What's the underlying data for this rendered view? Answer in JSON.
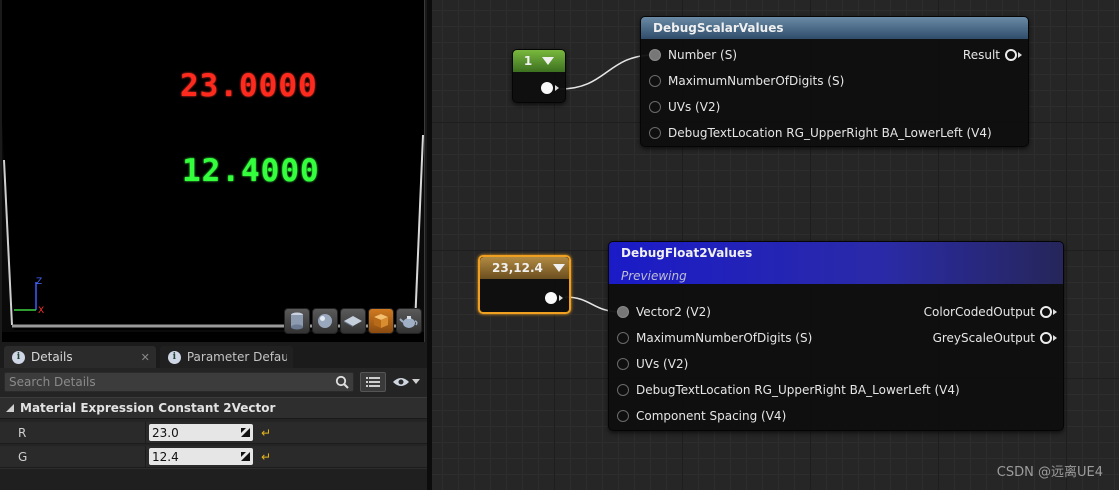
{
  "viewport": {
    "values": [
      "23.0000",
      "12.4000"
    ],
    "axes": {
      "z": "Z",
      "x": "X"
    },
    "preview_shapes": [
      "cylinder-icon",
      "sphere-icon",
      "plane-icon",
      "cube-icon",
      "teapot-icon"
    ],
    "active_shape": "cube-icon"
  },
  "details": {
    "tabs": [
      {
        "label": "Details",
        "icon": "info-icon",
        "active": true
      },
      {
        "label": "Parameter Default:",
        "icon": "info-icon",
        "active": false
      }
    ],
    "search_placeholder": "Search Details",
    "category": "Material Expression Constant 2Vector",
    "properties": [
      {
        "label": "R",
        "value": "23.0"
      },
      {
        "label": "G",
        "value": "12.4"
      }
    ]
  },
  "graph": {
    "constant_scalar": {
      "value": "1"
    },
    "constant_vector": {
      "value": "23,12.4"
    },
    "scalar_node": {
      "title": "DebugScalarValues",
      "inputs": [
        "Number (S)",
        "MaximumNumberOfDigits (S)",
        "UVs (V2)",
        "DebugTextLocation RG_UpperRight BA_LowerLeft (V4)"
      ],
      "outputs": [
        "Result"
      ]
    },
    "float2_node": {
      "title": "DebugFloat2Values",
      "subtitle": "Previewing",
      "inputs": [
        "Vector2 (V2)",
        "MaximumNumberOfDigits (S)",
        "UVs (V2)",
        "DebugTextLocation RG_UpperRight BA_LowerLeft (V4)",
        "Component Spacing (V4)"
      ],
      "outputs": [
        "ColorCodedOutput",
        "GreyScaleOutput"
      ]
    }
  },
  "watermark": "CSDN @远离UE4",
  "colors": {
    "red_value": "#ff2a1e",
    "green_value": "#33ff3c",
    "selected_outline": "#f0a020"
  }
}
